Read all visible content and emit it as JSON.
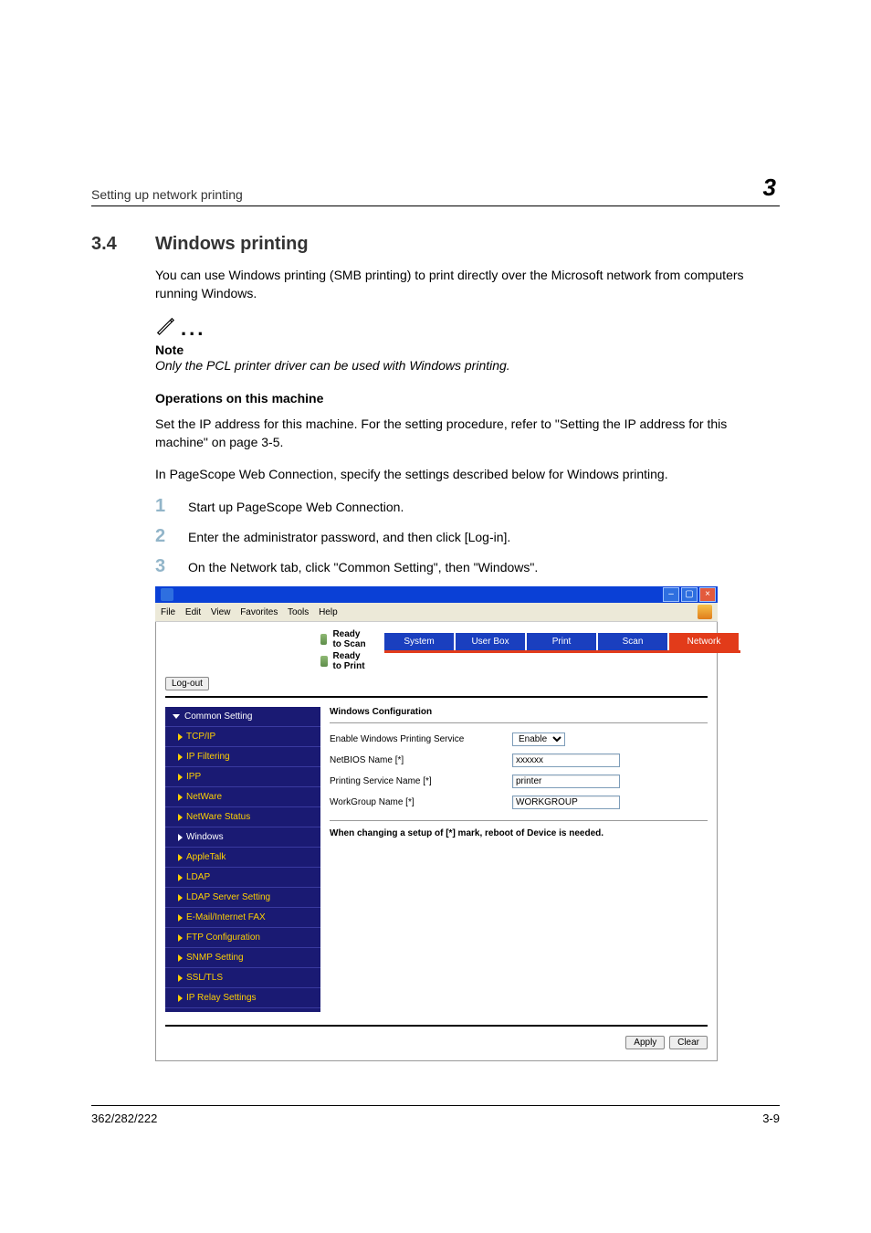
{
  "header": {
    "left": "Setting up network printing",
    "chapter": "3"
  },
  "section": {
    "number": "3.4",
    "title": "Windows printing"
  },
  "intro": "You can use Windows printing (SMB printing) to print directly over the Microsoft network from computers running Windows.",
  "note": {
    "label": "Note",
    "text": "Only the PCL printer driver can be used with Windows printing."
  },
  "subhead": "Operations on this machine",
  "para1": "Set the IP address for this machine. For the setting procedure, refer to \"Setting the IP address for this machine\" on page 3-5.",
  "para2": "In PageScope Web Connection, specify the settings described below for Windows printing.",
  "steps": [
    "Start up PageScope Web Connection.",
    "Enter the administrator password, and then click [Log-in].",
    "On the Network tab, click \"Common Setting\", then \"Windows\"."
  ],
  "browser": {
    "menus": [
      "File",
      "Edit",
      "View",
      "Favorites",
      "Tools",
      "Help"
    ],
    "status": {
      "scan": "Ready to Scan",
      "print": "Ready to Print"
    },
    "logout": "Log-out",
    "tabs": [
      "System",
      "User Box",
      "Print",
      "Scan",
      "Network"
    ],
    "sidebar": {
      "header": "Common Setting",
      "items": [
        {
          "label": "TCP/IP"
        },
        {
          "label": "IP Filtering"
        },
        {
          "label": "IPP"
        },
        {
          "label": "NetWare"
        },
        {
          "label": "NetWare Status"
        },
        {
          "label": "Windows",
          "current": true
        },
        {
          "label": "AppleTalk"
        },
        {
          "label": "LDAP"
        },
        {
          "label": "LDAP Server Setting"
        },
        {
          "label": "E-Mail/Internet FAX"
        },
        {
          "label": "FTP Configuration"
        },
        {
          "label": "SNMP Setting"
        },
        {
          "label": "SSL/TLS"
        },
        {
          "label": "IP Relay Settings"
        }
      ]
    },
    "main": {
      "title": "Windows Configuration",
      "fields": {
        "enable_label": "Enable Windows Printing Service",
        "enable_value": "Enable",
        "netbios_label": "NetBIOS Name [*]",
        "netbios_value": "xxxxxx",
        "printsvc_label": "Printing Service Name [*]",
        "printsvc_value": "printer",
        "workgroup_label": "WorkGroup Name [*]",
        "workgroup_value": "WORKGROUP"
      },
      "reboot_note": "When changing a setup of [*] mark, reboot of Device is needed."
    },
    "buttons": {
      "apply": "Apply",
      "clear": "Clear"
    }
  },
  "footer": {
    "left": "362/282/222",
    "right": "3-9"
  }
}
